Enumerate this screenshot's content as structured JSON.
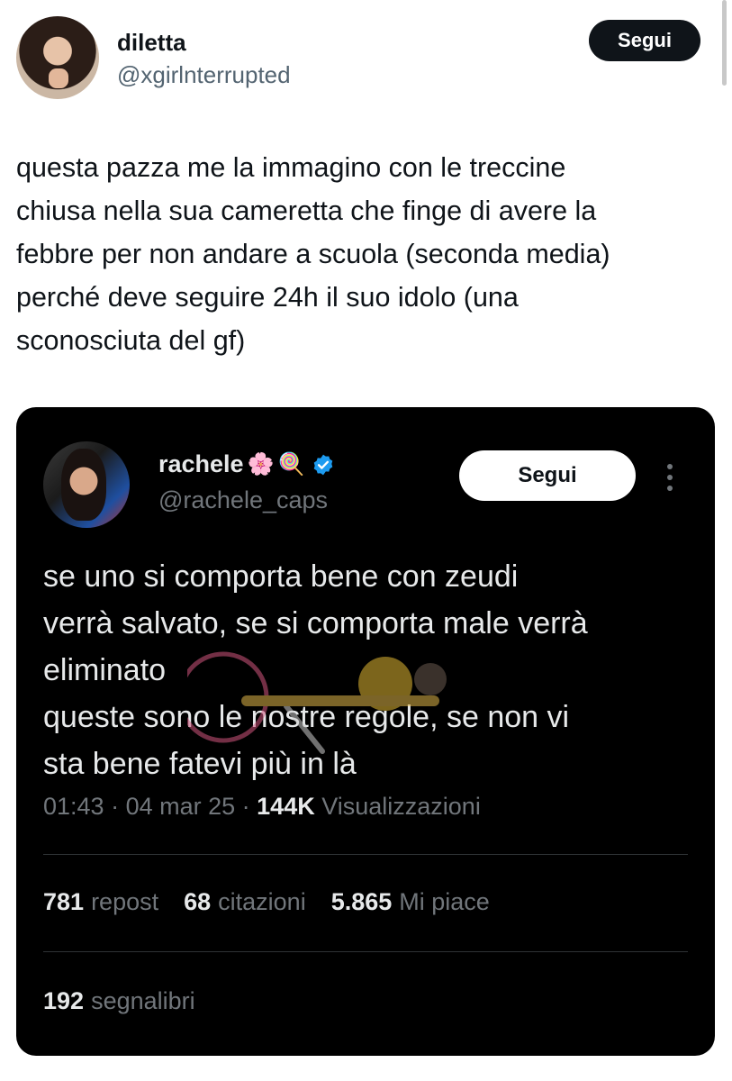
{
  "outer_tweet": {
    "display_name": "diletta",
    "handle": "@xgirlnterrupted",
    "follow_label": "Segui",
    "text": "questa pazza me la immagino con le treccine\nchiusa nella sua cameretta che finge di avere la\nfebbre per non andare a scuola (seconda media)\nperché deve seguire 24h il suo idolo (una\nsconosciuta del gf)"
  },
  "quoted_tweet": {
    "display_name": "rachele",
    "name_emojis": [
      "🌸",
      "🍭"
    ],
    "verified": true,
    "handle": "@rachele_caps",
    "follow_label": "Segui",
    "text": "se uno si comporta bene con zeudi\nverrà salvato, se si comporta male verrà\neliminato\nqueste sono le nostre regole, se non vi\nsta bene fatevi più in là",
    "time": "01:43",
    "date": "04 mar 25",
    "views_count": "144K",
    "views_label": "Visualizzazioni",
    "reposts_count": "781",
    "reposts_label": "repost",
    "quotes_count": "68",
    "quotes_label": "citazioni",
    "likes_count": "5.865",
    "likes_label": "Mi piace",
    "bookmarks_count": "192",
    "bookmarks_label": "segnalibri"
  },
  "colors": {
    "light_text": "#0f1419",
    "light_secondary": "#536471",
    "dark_bg": "#000000",
    "dark_text": "#e7e9ea",
    "dark_secondary": "#71767b",
    "verified_blue": "#1d9bf0"
  },
  "icons": [
    "avatar",
    "verified-badge-icon",
    "more-options-icon"
  ]
}
